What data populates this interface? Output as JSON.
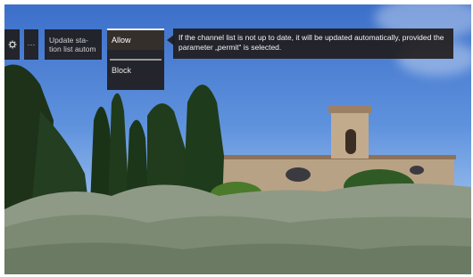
{
  "toolbar": {
    "settings_icon": "gear-icon",
    "more_label": "···",
    "update_label_line1": "Update sta-",
    "update_label_line2": "tion list autom"
  },
  "menu": {
    "items": [
      {
        "label": "Allow",
        "selected": true
      },
      {
        "label": "Block",
        "selected": false
      }
    ]
  },
  "tooltip": {
    "text": "If the channel list is not up to date, it will be updated automatically, provided the parameter „permit“ is selected."
  }
}
